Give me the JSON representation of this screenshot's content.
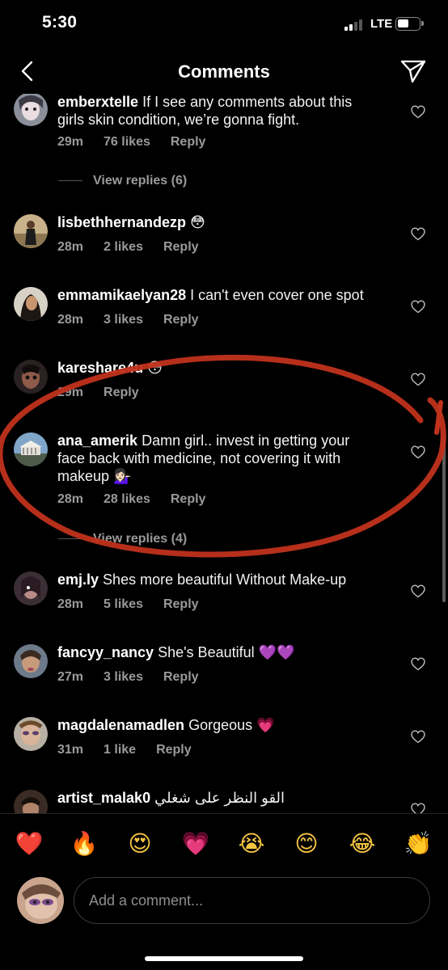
{
  "status_bar": {
    "time": "5:30",
    "network": "LTE"
  },
  "header": {
    "title": "Comments"
  },
  "comments": [
    {
      "username": "emberxtelle",
      "text": "If I see any comments about this girls skin condition, we’re gonna fight.",
      "time": "29m",
      "likes": "76 likes",
      "reply": "Reply",
      "view_replies": "View replies (6)"
    },
    {
      "username": "lisbethhernandezp",
      "text": "😳",
      "time": "28m",
      "likes": "2 likes",
      "reply": "Reply"
    },
    {
      "username": "emmamikaelyan28",
      "text": "I can't even cover one spot",
      "time": "28m",
      "likes": "3 likes",
      "reply": "Reply"
    },
    {
      "username": "kareshare4u",
      "text": "😳",
      "time": "29m",
      "reply": "Reply"
    },
    {
      "username": "ana_amerik",
      "text": "Damn girl.. invest in getting your face back with medicine, not covering it with makeup 💁🏻‍♀️",
      "time": "28m",
      "likes": "28 likes",
      "reply": "Reply",
      "view_replies": "View replies (4)"
    },
    {
      "username": "emj.ly",
      "text": "Shes more beautiful Without Make-up",
      "time": "28m",
      "likes": "5 likes",
      "reply": "Reply"
    },
    {
      "username": "fancyy_nancy",
      "text": "She's Beautiful 💜💜",
      "time": "27m",
      "likes": "3 likes",
      "reply": "Reply"
    },
    {
      "username": "magdalenamadlen",
      "text": "Gorgeous 💗",
      "time": "31m",
      "likes": "1 like",
      "reply": "Reply"
    },
    {
      "username": "artist_malak0",
      "text": "القو النظر على شغلي"
    }
  ],
  "quick_reactions": [
    "❤️",
    "🔥",
    "😍",
    "💗",
    "😭",
    "😊",
    "😂",
    "👏"
  ],
  "composer": {
    "placeholder": "Add a comment..."
  },
  "colors": {
    "background": "#000000",
    "meta_text": "#9a9a9a",
    "annotation_red": "#c0321c"
  },
  "icons": [
    "back-chevron-icon",
    "send-paper-plane-icon",
    "heart-outline-icon"
  ]
}
